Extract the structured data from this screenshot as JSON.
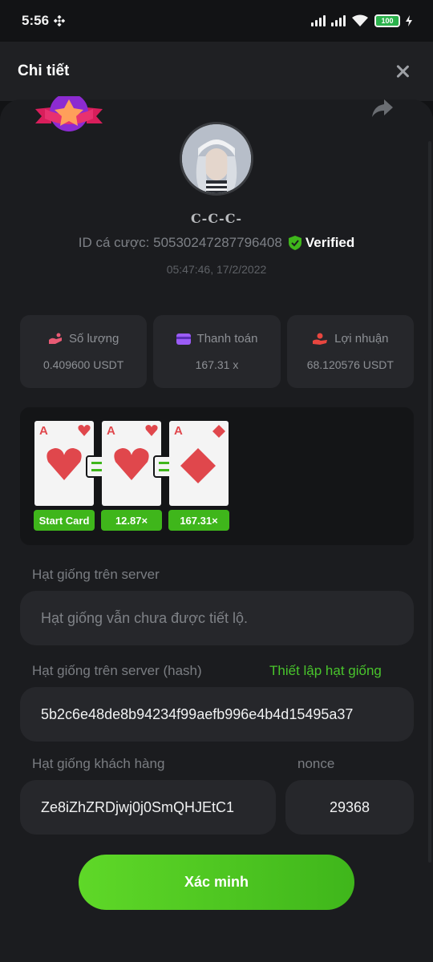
{
  "status_bar": {
    "time": "5:56",
    "battery": "100"
  },
  "header": {
    "title": "Chi tiết"
  },
  "profile": {
    "username": "C-C-C-",
    "bet_id": "ID cá cược: 5053024728779640​8",
    "verified_label": "Verified",
    "datetime": "05:47:46, 17/2/2022"
  },
  "stats": [
    {
      "label": "Số lượng",
      "value": "0.409600 USDT",
      "icon": "bet-amount-icon"
    },
    {
      "label": "Thanh toán",
      "value": "167.31 x",
      "icon": "card-payout-icon"
    },
    {
      "label": "Lợi nhuận",
      "value": "68.120576 USDT",
      "icon": "profit-hand-icon"
    }
  ],
  "cards": [
    {
      "rank": "A",
      "suit": "heart"
    },
    {
      "rank": "A",
      "suit": "heart"
    },
    {
      "rank": "A",
      "suit": "diamond"
    }
  ],
  "card_tags": [
    "Start Card",
    "12.87×",
    "167.31×"
  ],
  "fields": {
    "server_seed_label": "Hạt giống trên server",
    "server_seed_value": "Hạt giống vẫn chưa được tiết lộ.",
    "server_hash_label": "Hạt giống trên server (hash)",
    "set_seed_link": "Thiết lập hạt giống",
    "server_hash_value": "5b2c6e48de8b94234f99aefb996e4b4d15495a37",
    "client_seed_label": "Hạt giống khách hàng",
    "client_seed_value": "Ze8iZhZRDjwj0j0SmQHJEtC1",
    "nonce_label": "nonce",
    "nonce_value": "29368"
  },
  "verify_button": "Xác minh",
  "colors": {
    "accent_green": "#3fb61b",
    "card_red": "#e0474c",
    "background": "#1b1c1f"
  }
}
